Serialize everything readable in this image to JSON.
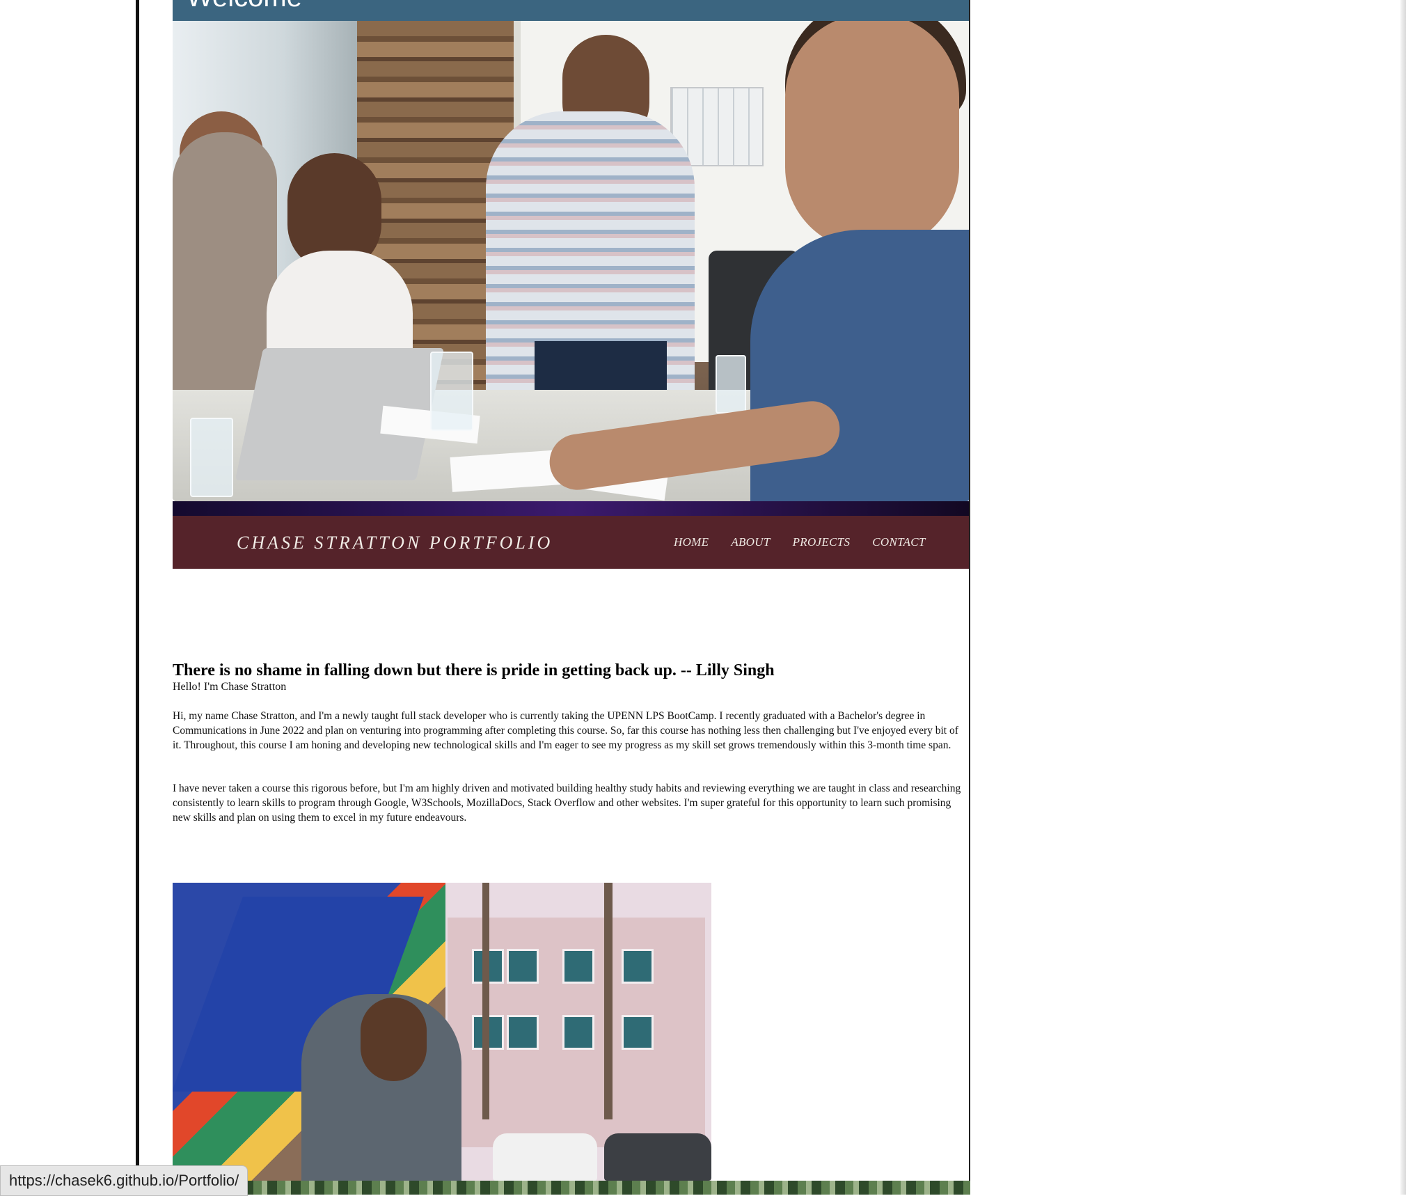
{
  "header": {
    "partial_title": "Welcome"
  },
  "hero_image": {
    "alt": "Team meeting around a table with laptop"
  },
  "navbar": {
    "brand": "CHASE STRATTON PORTFOLIO",
    "links": [
      "HOME",
      "ABOUT",
      "PROJECTS",
      "CONTACT"
    ]
  },
  "content": {
    "quote": "There is no shame in falling down but there is pride in getting back up. -- Lilly Singh",
    "greeting": "Hello! I'm Chase Stratton",
    "paragraph1": "Hi, my name Chase Stratton, and I'm a newly taught full stack developer who is currently taking the UPENN LPS BootCamp. I recently graduated with a Bachelor's degree in Communications in June 2022 and plan on venturing into programming after completing this course. So, far this course has nothing less then challenging but I've enjoyed every bit of it. Throughout, this course I am honing and developing new technological skills and I'm eager to see my progress as my skill set grows tremendously within this 3-month time span.",
    "paragraph2": "I have never taken a course this rigorous before, but I'm am highly driven and motivated building healthy study habits and reviewing everything we are taught in class and researching consistently to learn skills to program through Google, W3Schools, MozillaDocs, Stack Overflow and other websites. I'm super grateful for this opportunity to learn such promising new skills and plan on using them to excel in my future endeavours."
  },
  "photo2": {
    "alt": "Chase Stratton on phone in front of a mural"
  },
  "status_bar": {
    "url": "https://chasek6.github.io/Portfolio/"
  },
  "colors": {
    "navbar": "#55232a",
    "header_strip": "#3b6580",
    "text": "#000000"
  }
}
